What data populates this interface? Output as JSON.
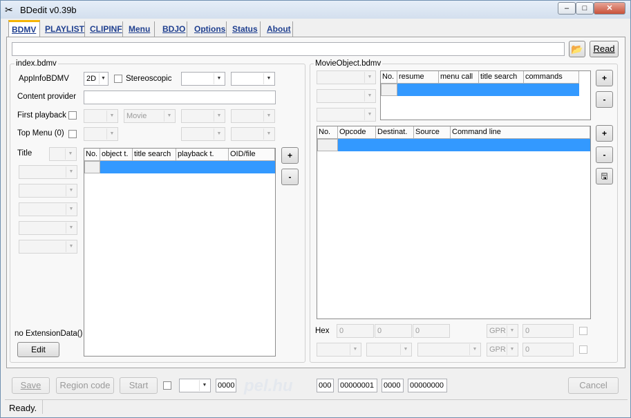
{
  "window": {
    "title": "BDedit v0.39b",
    "controls": [
      "minimize",
      "maximize",
      "close"
    ]
  },
  "tabs": [
    "BDMV",
    "PLAYLIST",
    "CLIPINF",
    "Menu",
    "BDJO",
    "Options",
    "Status",
    "About"
  ],
  "path_value": "",
  "read_label": "Read",
  "index": {
    "group_title": "index.bdmv",
    "appinfo_label": "AppInfoBDMV",
    "appinfo_value": "2D",
    "stereoscopic_label": "Stereoscopic",
    "content_provider_label": "Content provider",
    "first_playback_label": "First playback",
    "movie_value": "Movie",
    "top_menu_label": "Top Menu (0)",
    "title_label": "Title",
    "columns": [
      "No.",
      "object t.",
      "title search",
      "playback t.",
      "OID/file"
    ],
    "add_label": "+",
    "remove_label": "-",
    "ext_label": "no ExtensionData()",
    "edit_label": "Edit"
  },
  "movie": {
    "group_title": "MovieObject.bdmv",
    "top_columns": [
      "No.",
      "resume",
      "menu call",
      "title search",
      "commands"
    ],
    "cmd_columns": [
      "No.",
      "Opcode",
      "Destinat.",
      "Source",
      "Command line"
    ],
    "add_label": "+",
    "remove_label": "-",
    "hex_label": "Hex",
    "hex_values": [
      "0",
      "0",
      "0"
    ],
    "gpr_label": "GPR",
    "gpr_value1": "0",
    "gpr_value2": "0"
  },
  "bottom": {
    "save_label": "Save",
    "region_label": "Region code",
    "start_label": "Start",
    "field1": "0000",
    "watermark": "pel.hu",
    "f2": "000",
    "f3": "00000001",
    "f4": "0000",
    "f5": "00000000",
    "cancel_label": "Cancel"
  },
  "status_text": "Ready."
}
